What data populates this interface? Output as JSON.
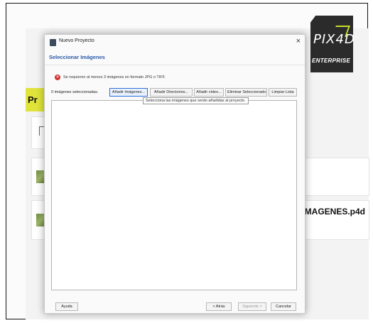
{
  "background_app": {
    "section_label": "Pr",
    "file_name": "E IMAGENES.p4d"
  },
  "logo": {
    "brand": "PIX4D",
    "edition": "ENTERPRISE",
    "colors": {
      "background": "#2b2b2b",
      "accent": "#c9dd2c"
    }
  },
  "dialog": {
    "window_title": "Nuevo Proyecto",
    "close_glyph": "×",
    "heading": "Seleccionar Imágenes",
    "error_icon": "x-circle-icon",
    "error_message": "Se requieren al menos 3 imágenes en formato JPG o TIFF.",
    "selected_count": "0 imágenes seleccionadas.",
    "buttons": {
      "add_images": "Añadir Imágenes...",
      "add_directories": "Añadir Directorios...",
      "add_video": "Añadir vídeo...",
      "remove_selected": "Eliminar Seleccionado",
      "clear_list": "Limpiar Lista"
    },
    "tooltip": "Selecciona las imágenes que serán añadidas al proyecto.",
    "footer": {
      "help": "Ayuda",
      "back": "< Atrás",
      "next": "Siguiente >",
      "cancel": "Cancelar"
    },
    "colors": {
      "heading": "#2b5aa8",
      "error": "#d13434",
      "focus": "#2b6fd6"
    }
  }
}
